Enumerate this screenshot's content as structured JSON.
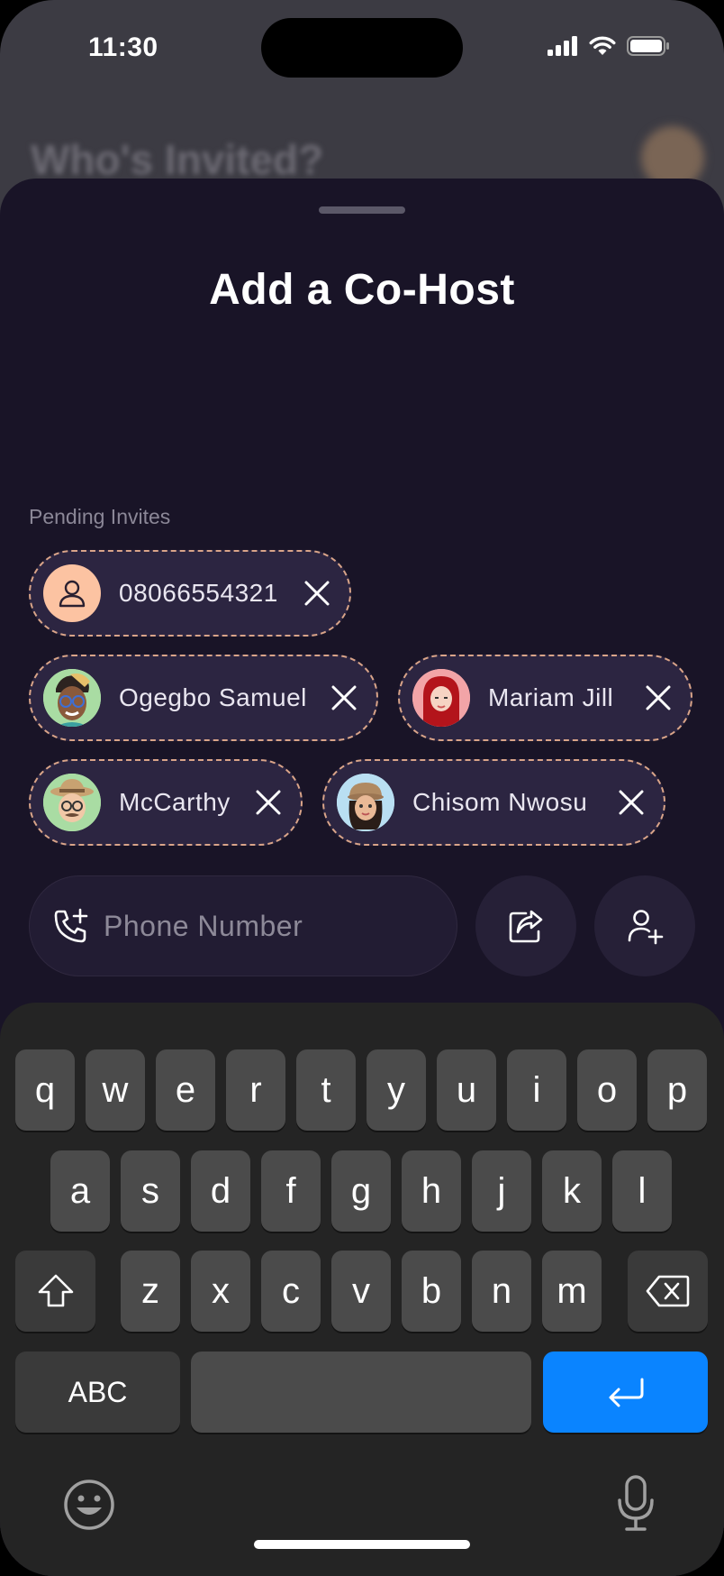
{
  "status_bar": {
    "time": "11:30"
  },
  "background": {
    "title": "Who's Invited?"
  },
  "sheet": {
    "title": "Add a Co-Host",
    "section_label": "Pending Invites",
    "invites": [
      {
        "label": "08066554321",
        "avatar": "person-icon"
      },
      {
        "label": "Ogegbo Samuel",
        "avatar": "memoji-ogegbo"
      },
      {
        "label": "Mariam Jill",
        "avatar": "memoji-mariam"
      },
      {
        "label": "McCarthy",
        "avatar": "memoji-mccarthy"
      },
      {
        "label": "Chisom Nwosu",
        "avatar": "memoji-chisom"
      }
    ],
    "phone_input": {
      "placeholder": "Phone Number",
      "value": ""
    }
  },
  "keyboard": {
    "row1": [
      "q",
      "w",
      "e",
      "r",
      "t",
      "y",
      "u",
      "i",
      "o",
      "p"
    ],
    "row2": [
      "a",
      "s",
      "d",
      "f",
      "g",
      "h",
      "j",
      "k",
      "l"
    ],
    "row3": [
      "z",
      "x",
      "c",
      "v",
      "b",
      "n",
      "m"
    ],
    "mode_key": "ABC"
  },
  "colors": {
    "sheet_bg": "#191427",
    "chip_bg": "#2c2541",
    "chip_border": "#d9a489",
    "return_key": "#0a84ff"
  }
}
